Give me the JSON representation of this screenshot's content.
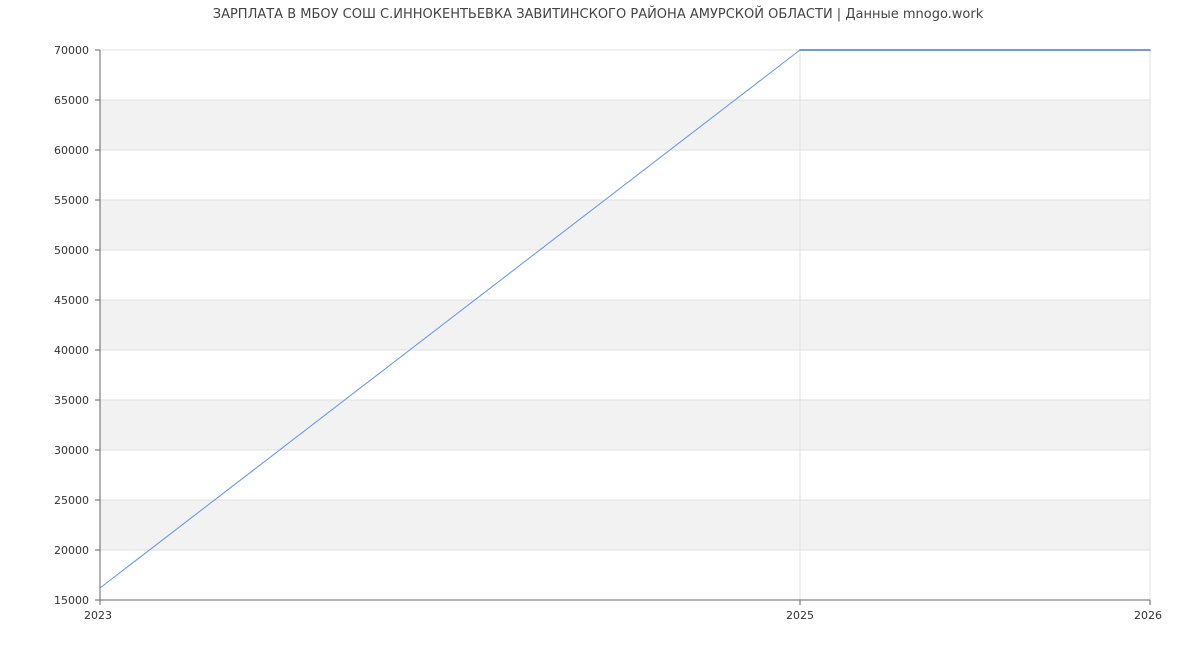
{
  "chart_data": {
    "type": "line",
    "title": "ЗАРПЛАТА В МБОУ СОШ С.ИННОКЕНТЬЕВКА ЗАВИТИНСКОГО РАЙОНА АМУРСКОЙ ОБЛАСТИ | Данные mnogo.work",
    "xlabel": "",
    "ylabel": "",
    "x_ticks": [
      "2023",
      "2025",
      "2026"
    ],
    "y_ticks": [
      "15000",
      "20000",
      "25000",
      "30000",
      "35000",
      "40000",
      "45000",
      "50000",
      "55000",
      "60000",
      "65000",
      "70000"
    ],
    "xlim": [
      2023,
      2026
    ],
    "ylim": [
      15000,
      70000
    ],
    "series": [
      {
        "x": [
          2023,
          2025,
          2026
        ],
        "values": [
          16200,
          70000,
          70000
        ]
      }
    ],
    "grid": true,
    "alternating_bands": true,
    "legend": "none",
    "colors": {
      "line": "#6f9ae6",
      "line_flat": "#4a78c8",
      "band": "#f2f2f2",
      "grid": "#e0e0e0",
      "axis": "#666666"
    }
  }
}
